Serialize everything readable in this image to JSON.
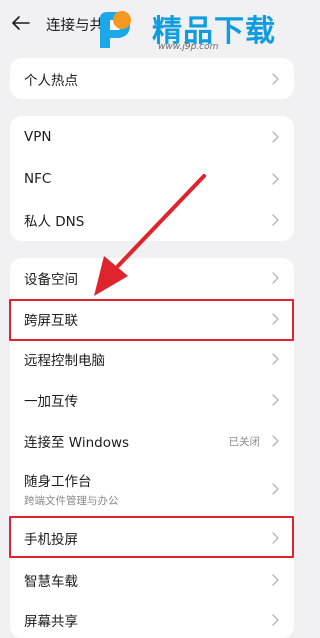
{
  "header": {
    "title": "连接与共享",
    "back_icon": "arrow-left-icon"
  },
  "watermark": {
    "brand": "精品下载",
    "url": "www.j9p.com",
    "brand_color": "#0f9de0",
    "logo_icon": "p-logo-icon"
  },
  "groups": [
    {
      "items": [
        {
          "label": "个人热点"
        }
      ]
    },
    {
      "items": [
        {
          "label": "VPN"
        },
        {
          "label": "NFC"
        },
        {
          "label": "私人 DNS"
        }
      ]
    },
    {
      "items": [
        {
          "label": "设备空间"
        },
        {
          "label": "跨屏互联"
        },
        {
          "label": "远程控制电脑"
        },
        {
          "label": "一加互传"
        },
        {
          "label": "连接至 Windows",
          "status": "已关闭"
        },
        {
          "label": "随身工作台",
          "subtitle": "跨端文件管理与办公"
        },
        {
          "label": "手机投屏"
        },
        {
          "label": "智慧车载"
        },
        {
          "label": "屏幕共享"
        }
      ]
    }
  ],
  "annotations": {
    "highlight_color": "#e0242e"
  }
}
